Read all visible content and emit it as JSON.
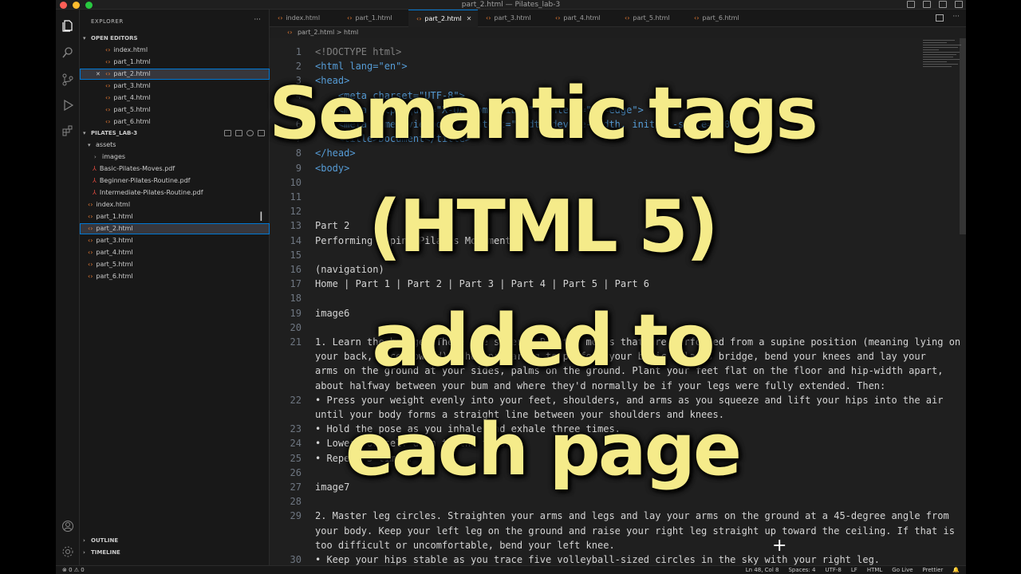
{
  "window": {
    "title": "part_2.html — Pilates_lab-3"
  },
  "sidebar": {
    "title": "EXPLORER",
    "open_editors_label": "OPEN EDITORS",
    "open_editors": [
      "index.html",
      "part_1.html",
      "part_2.html",
      "part_3.html",
      "part_4.html",
      "part_5.html",
      "part_6.html"
    ],
    "project_label": "PILATES_LAB-3",
    "folders": [
      "assets",
      "images"
    ],
    "pdfs": [
      "Basic-Pilates-Moves.pdf",
      "Beginner-Pilates-Routine.pdf",
      "Intermediate-Pilates-Routine.pdf"
    ],
    "files": [
      "index.html",
      "part_1.html",
      "part_2.html",
      "part_3.html",
      "part_4.html",
      "part_5.html",
      "part_6.html"
    ],
    "outline_label": "OUTLINE",
    "timeline_label": "TIMELINE"
  },
  "tabs": [
    "index.html",
    "part_1.html",
    "part_2.html",
    "part_3.html",
    "part_4.html",
    "part_5.html",
    "part_6.html"
  ],
  "active_tab": "part_2.html",
  "breadcrumb": {
    "file": "part_2.html",
    "sep": ">",
    "node": "html"
  },
  "code_lines": [
    {
      "n": "1",
      "text": "<!DOCTYPE html>"
    },
    {
      "n": "2",
      "text": "<html lang=\"en\">"
    },
    {
      "n": "3",
      "text": "<head>"
    },
    {
      "n": "4",
      "text": "    <meta charset=\"UTF-8\">"
    },
    {
      "n": "5",
      "text": "    <meta http-equiv=\"X-UA-Compatible\" content=\"IE=edge\">"
    },
    {
      "n": "6",
      "text": "    <meta name=\"viewport\" content=\"width=device-width, initial-scale=1.0\">"
    },
    {
      "n": "7",
      "text": "    <title>Document</title>"
    },
    {
      "n": "8",
      "text": "</head>"
    },
    {
      "n": "9",
      "text": "<body>"
    },
    {
      "n": "10",
      "text": ""
    },
    {
      "n": "11",
      "text": ""
    },
    {
      "n": "12",
      "text": ""
    },
    {
      "n": "13",
      "text": "Part 2"
    },
    {
      "n": "14",
      "text": "Performing Supine Pilates Movements"
    },
    {
      "n": "15",
      "text": ""
    },
    {
      "n": "16",
      "text": "(navigation)"
    },
    {
      "n": "17",
      "text": "Home | Part 1 | Part 2 | Part 3 | Part 4 | Part 5 | Part 6"
    },
    {
      "n": "18",
      "text": ""
    },
    {
      "n": "19",
      "text": "image6"
    },
    {
      "n": "20",
      "text": ""
    },
    {
      "n": "21",
      "text": "1. Learn the bridge. There are several Pilates moves that are performed from a supine position (meaning lying on"
    },
    {
      "n": "",
      "text": "your back, face upward). When preparing to perform your basic Pilates bridge, bend your knees and lay your"
    },
    {
      "n": "",
      "text": "arms on the ground at your sides, palms on the ground. Plant your feet flat on the floor and hip-width apart,"
    },
    {
      "n": "",
      "text": "about halfway between your bum and where they'd normally be if your legs were fully extended. Then:"
    },
    {
      "n": "22",
      "text": "• Press your weight evenly into your feet, shoulders, and arms as you squeeze and lift your hips into the air"
    },
    {
      "n": "",
      "text": "until your body forms a straight line between your shoulders and knees."
    },
    {
      "n": "23",
      "text": "• Hold the pose as you inhale and exhale three times."
    },
    {
      "n": "24",
      "text": "• Lower yourself down to the floor."
    },
    {
      "n": "25",
      "text": "• Repeat 5 times."
    },
    {
      "n": "26",
      "text": ""
    },
    {
      "n": "27",
      "text": "image7"
    },
    {
      "n": "28",
      "text": ""
    },
    {
      "n": "29",
      "text": "2. Master leg circles. Straighten your arms and legs and lay your arms on the ground at a 45-degree angle from"
    },
    {
      "n": "",
      "text": "your body. Keep your left leg on the ground and raise your right leg straight up toward the ceiling. If that is"
    },
    {
      "n": "",
      "text": "too difficult or uncomfortable, bend your left knee."
    },
    {
      "n": "30",
      "text": "• Keep your hips stable as you trace five volleyball-sized circles in the sky with your right leg."
    }
  ],
  "status": {
    "problems": "⊗ 0 ⚠ 0",
    "position": "Ln 48, Col 8",
    "spaces": "Spaces: 4",
    "encoding": "UTF-8",
    "eol": "LF",
    "language": "HTML",
    "golive": "Go Live",
    "prettier": "Prettier"
  },
  "overlay": {
    "line1": "Semantic tags",
    "line2": "(HTML 5)",
    "line3": "added to",
    "line4": "each page"
  },
  "colors": {
    "overlay_text": "#f5eb8a",
    "accent": "#0078d4",
    "html_icon": "#e37933",
    "pdf_icon": "#e04a3f"
  }
}
